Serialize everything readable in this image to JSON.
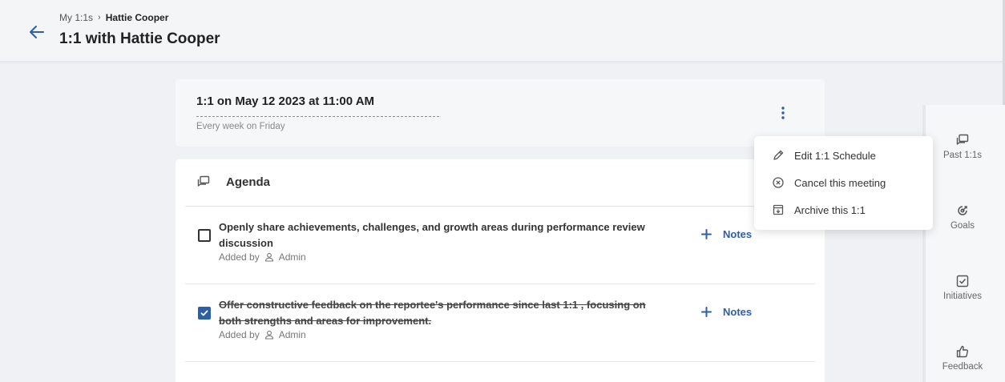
{
  "header": {
    "breadcrumbs": [
      "My 1:1s",
      "Hattie Cooper"
    ],
    "breadcrumb_separator": "›",
    "title": "1:1 with Hattie Cooper",
    "back_icon": "arrow-left-icon"
  },
  "meeting": {
    "title": "1:1 on May 12 2023 at 11:00 AM",
    "recurrence": "Every week on Friday",
    "more_icon": "kebab-vertical-icon"
  },
  "agenda": {
    "title": "Agenda",
    "icon": "chat-icon",
    "items": [
      {
        "text": "Openly share achievements, challenges, and growth areas during performance review discussion",
        "checked": false,
        "added_by_label": "Added by",
        "author": "Admin",
        "notes_label": "Notes"
      },
      {
        "text": "Offer constructive feedback on the reportee's performance since last 1:1 , focusing on both strengths and areas for improvement.",
        "checked": true,
        "added_by_label": "Added by",
        "author": "Admin",
        "notes_label": "Notes"
      }
    ]
  },
  "menu": {
    "items": [
      {
        "label": "Edit 1:1 Schedule",
        "icon": "pencil-icon"
      },
      {
        "label": "Cancel this meeting",
        "icon": "cancel-circle-icon"
      },
      {
        "label": "Archive this 1:1",
        "icon": "archive-icon"
      }
    ]
  },
  "sidebar": {
    "items": [
      {
        "label": "Past 1:1s",
        "icon": "chat-icon"
      },
      {
        "label": "Goals",
        "icon": "target-icon"
      },
      {
        "label": "Initiatives",
        "icon": "checkbox-icon"
      },
      {
        "label": "Feedback",
        "icon": "thumbs-up-icon"
      }
    ]
  },
  "colors": {
    "accent": "#2d5ea8",
    "background": "#eff1f4",
    "card": "#ffffff"
  }
}
